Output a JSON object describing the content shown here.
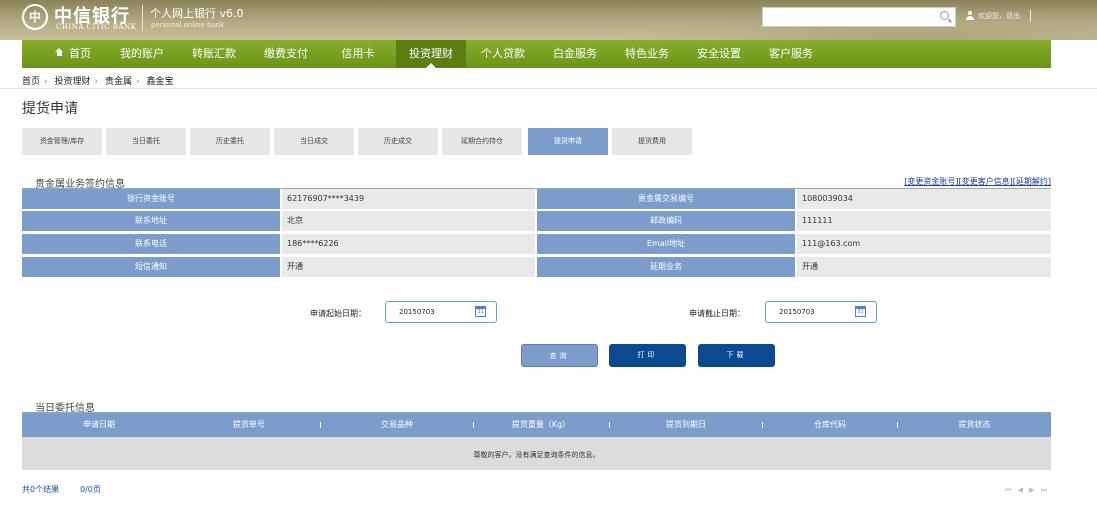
{
  "header": {
    "logo_mark": "中",
    "logo_cn": "中信银行",
    "logo_en": "CHINA CITIC BANK",
    "title": "个人网上银行 v6.0",
    "subtitle": "personal online bank",
    "search_placeholder": "",
    "user_text": "欢迎您，退出"
  },
  "nav": {
    "items": [
      {
        "label": "首页"
      },
      {
        "label": "我的账户"
      },
      {
        "label": "转账汇款"
      },
      {
        "label": "缴费支付"
      },
      {
        "label": "信用卡"
      },
      {
        "label": "投资理财"
      },
      {
        "label": "个人贷款"
      },
      {
        "label": "白金服务"
      },
      {
        "label": "特色业务"
      },
      {
        "label": "安全设置"
      },
      {
        "label": "客户服务"
      }
    ]
  },
  "breadcrumb": [
    "首页",
    "投资理财",
    "贵金属",
    "鑫金宝"
  ],
  "page_title": "提货申请",
  "tabs": [
    "资金管理/库存",
    "当日委托",
    "历史委托",
    "当日成交",
    "历史成交",
    "延期合约持仓",
    "提货申请",
    "提货费用"
  ],
  "sign_info": {
    "title": "贵金属业务签约信息",
    "links": "[变更资金账号][变更客户信息][延期解约]",
    "rows": [
      {
        "l1": "银行资金账号",
        "v1": "62176907****3439",
        "l2": "贵金属交易编号",
        "v2": "1080039034"
      },
      {
        "l1": "联系地址",
        "v1": "北京",
        "l2": "邮政编码",
        "v2": "111111"
      },
      {
        "l1": "联系电话",
        "v1": "186****6226",
        "l2": "Email地址",
        "v2": "111@163.com"
      },
      {
        "l1": "短信通知",
        "v1": "开通",
        "l2": "延期业务",
        "v2": "开通"
      }
    ]
  },
  "filter": {
    "start_label": "申请起始日期：",
    "start_value": "20150703",
    "end_label": "申请截止日期：",
    "end_value": "20150703",
    "cal_text": "31"
  },
  "buttons": {
    "query": "查询",
    "print": "打印",
    "download": "下载"
  },
  "results": {
    "title": "当日委托信息",
    "columns": [
      "申请日期",
      "提货单号",
      "交易品种",
      "提货重量（Kg）",
      "提货到期日",
      "仓库代码",
      "提货状态"
    ],
    "empty_message": "尊敬的客户，没有满足查询条件的信息。",
    "count_text": "共0个结果",
    "page_text": "0/0页",
    "pager": "⏮ ◀ ▶ ⏭"
  }
}
